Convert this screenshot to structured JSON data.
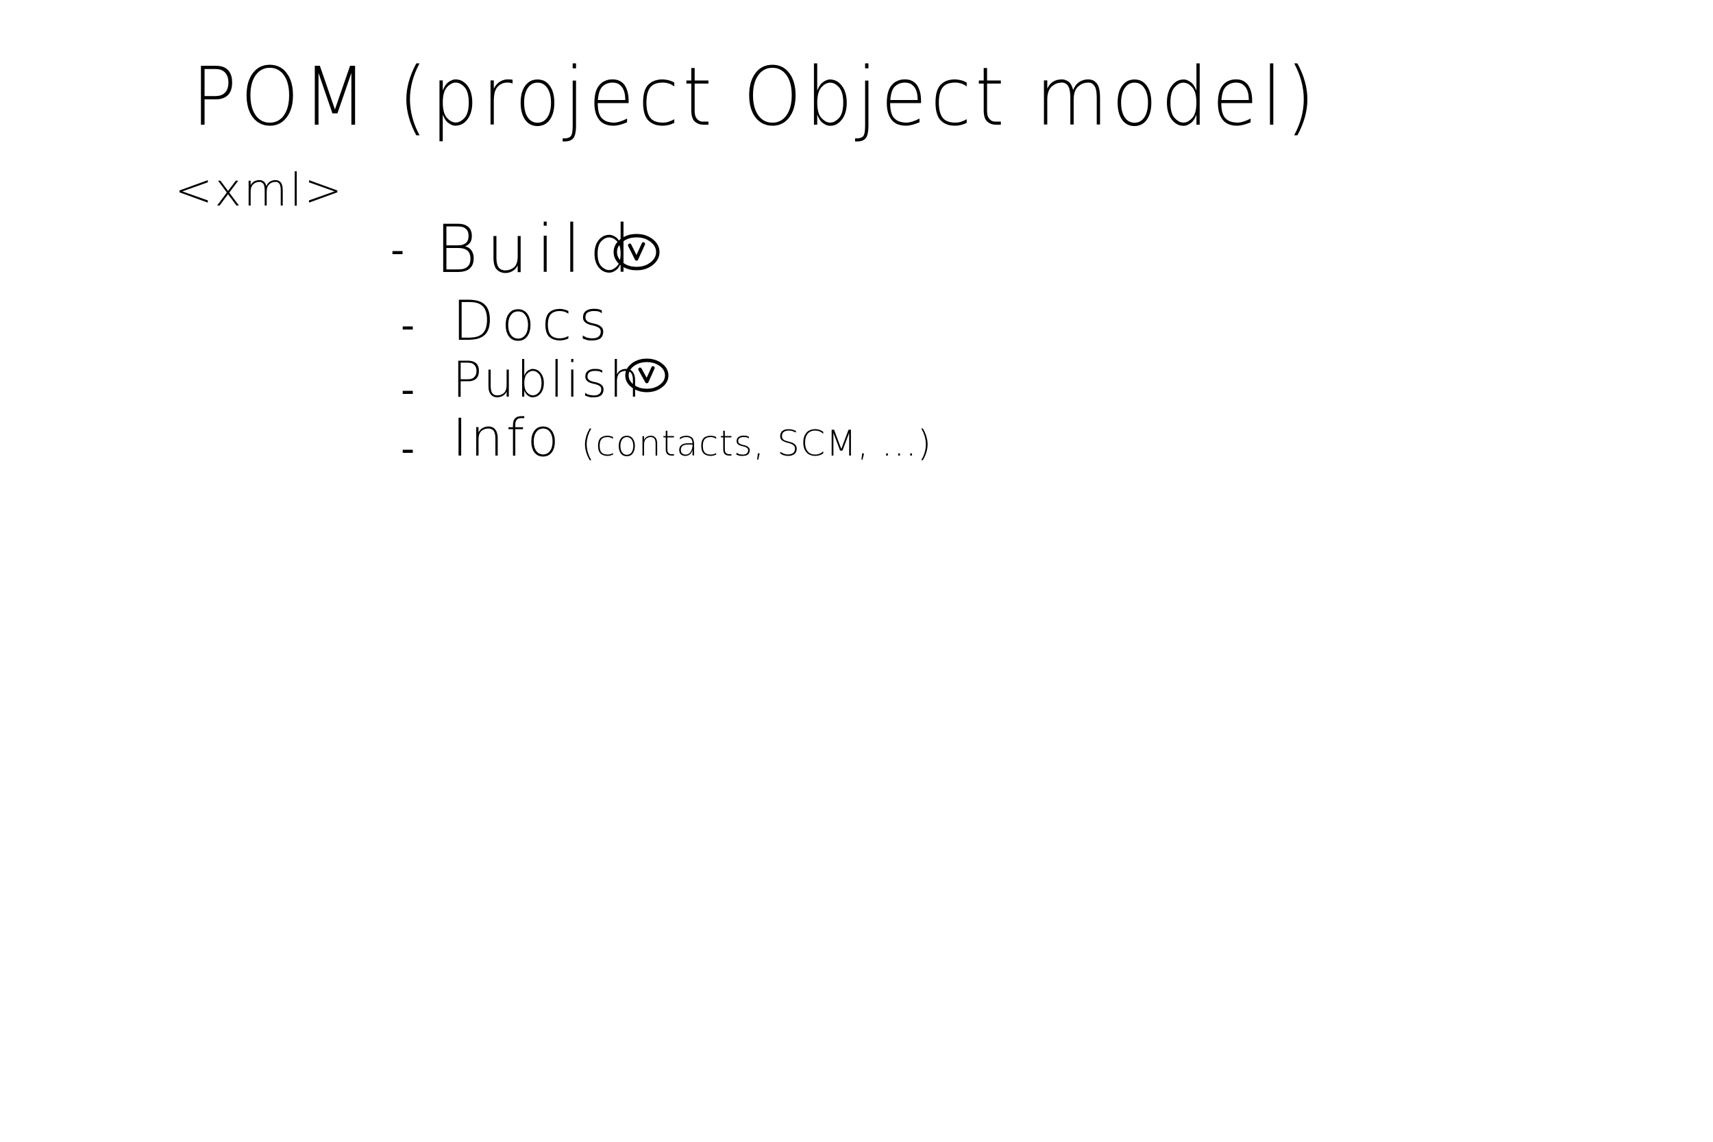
{
  "notes": {
    "title": "POM (project Object model)",
    "tag": "<xml>",
    "items": [
      {
        "label": "Build",
        "checked": true
      },
      {
        "label": "Docs",
        "checked": false
      },
      {
        "label": "Publish",
        "checked": true
      },
      {
        "label": "Info",
        "detail": "(contacts, SCM, ...)",
        "checked": false
      }
    ],
    "bullet": "-",
    "colors": {
      "ink": "#000000",
      "background": "#ffffff"
    },
    "icons": [
      "circled-check-icon"
    ]
  }
}
